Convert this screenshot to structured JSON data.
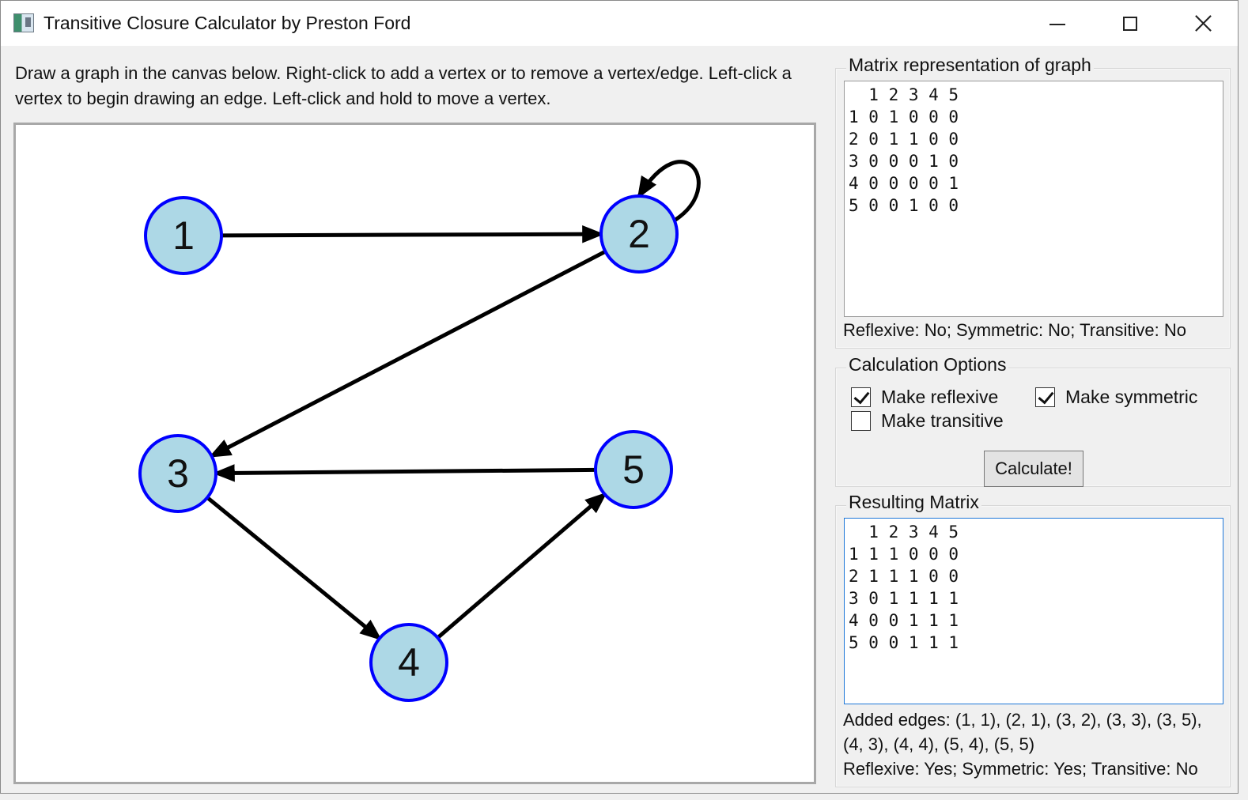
{
  "window": {
    "title": "Transitive Closure Calculator by Preston Ford"
  },
  "instructions": "Draw a graph in the canvas below. Right-click to add a vertex or to remove a vertex/edge. Left-click a vertex to begin drawing an edge. Left-click and hold to move a vertex.",
  "graph": {
    "vertices": [
      {
        "id": "1",
        "label": "1"
      },
      {
        "id": "2",
        "label": "2"
      },
      {
        "id": "3",
        "label": "3"
      },
      {
        "id": "4",
        "label": "4"
      },
      {
        "id": "5",
        "label": "5"
      }
    ],
    "edges": [
      {
        "from": "1",
        "to": "2"
      },
      {
        "from": "2",
        "to": "2"
      },
      {
        "from": "2",
        "to": "3"
      },
      {
        "from": "5",
        "to": "3"
      },
      {
        "from": "3",
        "to": "4"
      },
      {
        "from": "4",
        "to": "5"
      }
    ]
  },
  "matrix_group": {
    "title": "Matrix representation of graph",
    "text": "  1 2 3 4 5\n1 0 1 0 0 0\n2 0 1 1 0 0\n3 0 0 0 1 0\n4 0 0 0 0 1\n5 0 0 1 0 0",
    "properties": "Reflexive: No; Symmetric: No; Transitive: No"
  },
  "options": {
    "title": "Calculation Options",
    "make_reflexive": "Make reflexive",
    "make_symmetric": "Make symmetric",
    "make_transitive": "Make transitive",
    "calculate": "Calculate!"
  },
  "result_group": {
    "title": "Resulting Matrix",
    "text": "  1 2 3 4 5\n1 1 1 0 0 0\n2 1 1 1 0 0\n3 0 1 1 1 1\n4 0 0 1 1 1\n5 0 0 1 1 1",
    "added_edges_line1": "Added edges: (1, 1), (2, 1), (3, 2), (3, 3), (3, 5),",
    "added_edges_line2": "(4, 3), (4, 4), (5, 4), (5, 5)",
    "properties": "Reflexive: Yes; Symmetric: Yes; Transitive: No"
  }
}
